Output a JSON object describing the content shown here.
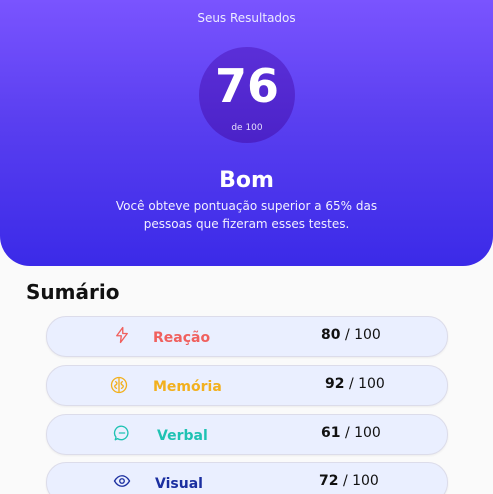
{
  "header": {
    "title": "Seus Resultados",
    "score": "76",
    "score_max": "de 100",
    "rating": "Bom",
    "description": "Você obteve pontuação superior a 65% das pessoas que fizeram esses testes."
  },
  "summary": {
    "heading": "Sumário",
    "separator": "/",
    "items": [
      {
        "label": "Reação",
        "score": "80",
        "max": "100",
        "color": "#f0605e",
        "icon": "lightning-icon"
      },
      {
        "label": "Memória",
        "score": "92",
        "max": "100",
        "color": "#f2b01e",
        "icon": "brain-icon"
      },
      {
        "label": "Verbal",
        "score": "61",
        "max": "100",
        "color": "#1fc2b3",
        "icon": "chat-bubble-icon"
      },
      {
        "label": "Visual",
        "score": "72",
        "max": "100",
        "color": "#1b2fa0",
        "icon": "eye-icon"
      }
    ]
  }
}
